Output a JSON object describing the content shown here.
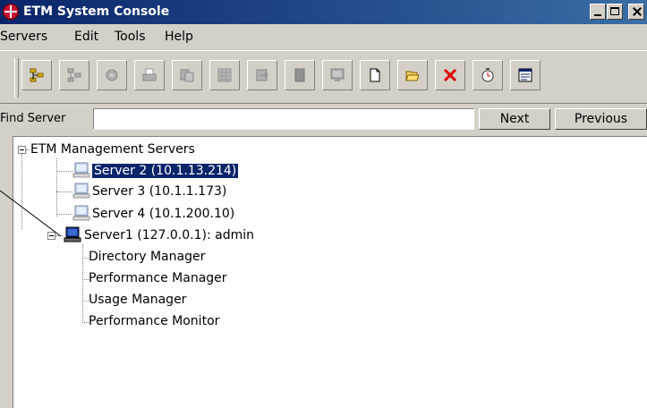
{
  "window": {
    "title": "ETM System Console"
  },
  "menu": [
    "Servers",
    "Edit",
    "Tools",
    "Help"
  ],
  "toolbar": {
    "icons": [
      "connect-icon",
      "disconnect-icon",
      "settings-icon",
      "print-icon",
      "copy-icon",
      "grid-icon",
      "export-icon",
      "stop-icon",
      "monitor-icon",
      "new-document-icon",
      "open-folder-icon",
      "delete-icon",
      "timer-icon",
      "properties-icon"
    ]
  },
  "find": {
    "label": "Find Server",
    "value": "",
    "next": "Next",
    "previous": "Previous"
  },
  "tree": {
    "root": "ETM Management Servers",
    "servers": [
      {
        "label": "Server 2 (10.1.13.214)",
        "selected": true
      },
      {
        "label": "Server 3 (10.1.1.173)"
      },
      {
        "label": "Server 4 (10.1.200.10)"
      },
      {
        "label": "Server1 (127.0.0.1): admin"
      }
    ],
    "children": [
      "Directory Manager",
      "Performance Manager",
      "Usage Manager",
      "Performance Monitor"
    ]
  },
  "colors": {
    "titlebar": "#0a246a",
    "selection": "#0a246a",
    "delete": "#e00000"
  }
}
